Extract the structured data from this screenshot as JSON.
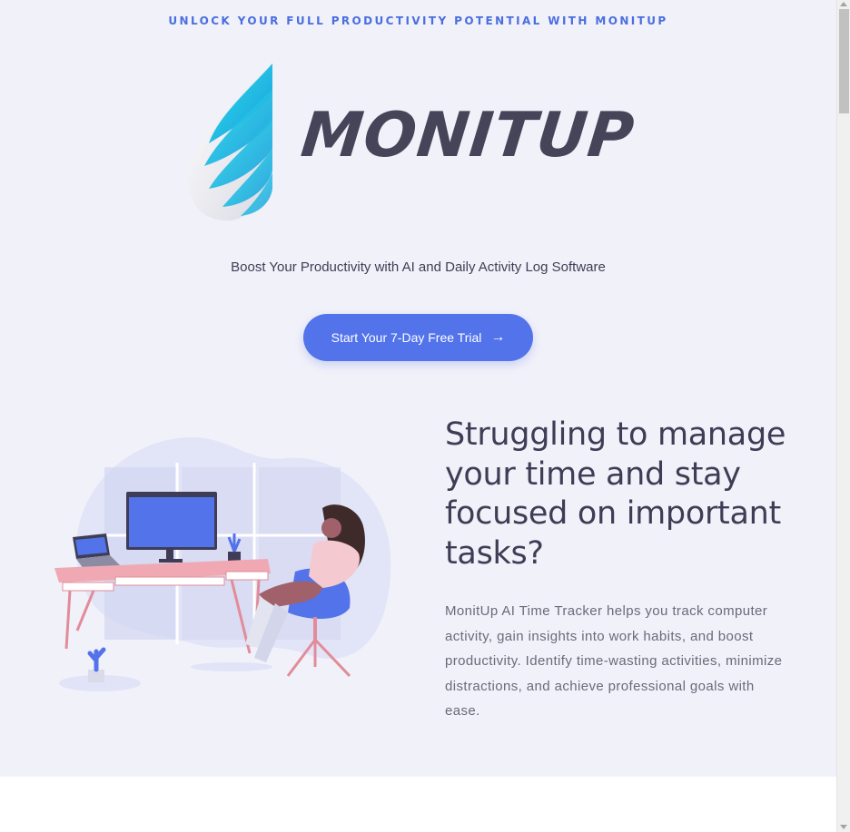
{
  "tagline": "UNLOCK YOUR FULL PRODUCTIVITY POTENTIAL WITH MONITUP",
  "logo": {
    "brand": "MONITUP",
    "icon": "leaf-wings-logo-icon"
  },
  "hero": {
    "subtitle": "Boost Your Productivity with AI and Daily Activity Log Software",
    "cta_label": "Start Your 7-Day Free Trial",
    "cta_icon": "arrow-right-icon",
    "cta_color": "#5273ea"
  },
  "feature": {
    "heading": "Struggling to manage your time and stay focused on important tasks?",
    "description": "MonitUp AI Time Tracker helps you track computer activity, gain insights into work habits, and boost productivity. Identify time-wasting activities, minimize distractions, and achieve professional goals with ease.",
    "illustration": "woman-at-desk-illustration"
  },
  "colors": {
    "background": "#f1f1f9",
    "accent": "#4a6ee0",
    "text": "#3f3d56"
  }
}
